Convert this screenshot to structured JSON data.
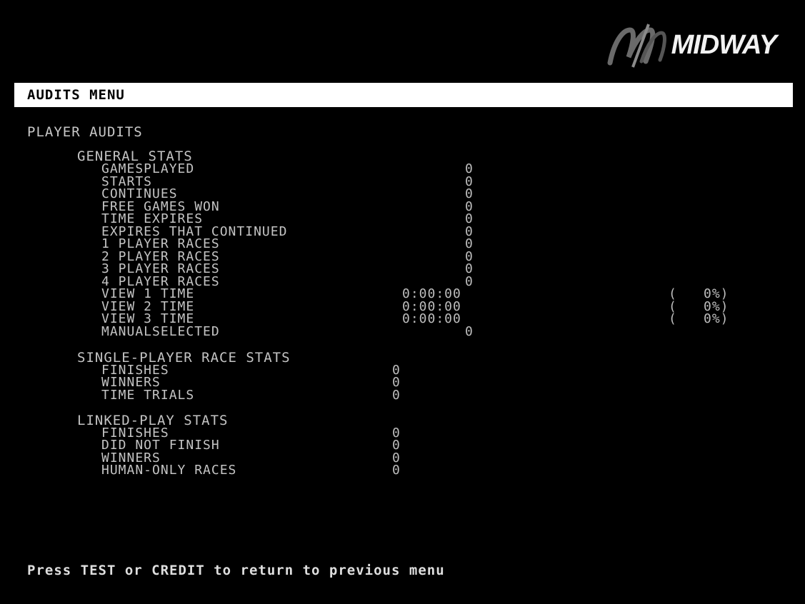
{
  "brand": {
    "logo_text": "MIDWAY",
    "logo_icon": "midway-m-logo"
  },
  "menu": {
    "title": "AUDITS MENU"
  },
  "section": {
    "title": "PLAYER AUDITS"
  },
  "general_stats": {
    "header": "GENERAL STATS",
    "rows": [
      {
        "label": "GAMESPLAYED",
        "value": "0"
      },
      {
        "label": "STARTS",
        "value": "0"
      },
      {
        "label": "CONTINUES",
        "value": "0"
      },
      {
        "label": "FREE GAMES WON",
        "value": "0"
      },
      {
        "label": "TIME EXPIRES",
        "value": "0"
      },
      {
        "label": "EXPIRES THAT CONTINUED",
        "value": "0"
      },
      {
        "label": "1 PLAYER RACES",
        "value": "0"
      },
      {
        "label": "2 PLAYER RACES",
        "value": "0"
      },
      {
        "label": "3 PLAYER RACES",
        "value": "0"
      },
      {
        "label": "4 PLAYER RACES",
        "value": "0"
      }
    ],
    "view_rows": [
      {
        "label": "VIEW 1 TIME",
        "value": "0:00:00",
        "pct_open": "(",
        "pct": "0%)"
      },
      {
        "label": "VIEW 2 TIME",
        "value": "0:00:00",
        "pct_open": "(",
        "pct": "0%)"
      },
      {
        "label": "VIEW 3 TIME",
        "value": "0:00:00",
        "pct_open": "(",
        "pct": "0%)"
      }
    ],
    "manual": {
      "label": "MANUALSELECTED",
      "value": "0"
    }
  },
  "single_player": {
    "header": "SINGLE-PLAYER RACE STATS",
    "rows": [
      {
        "label": "FINISHES",
        "value": "0"
      },
      {
        "label": "WINNERS",
        "value": "0"
      },
      {
        "label": "TIME TRIALS",
        "value": "0"
      }
    ]
  },
  "linked_play": {
    "header": "LINKED-PLAY STATS",
    "rows": [
      {
        "label": "FINISHES",
        "value": "0"
      },
      {
        "label": "DID NOT FINISH",
        "value": "0"
      },
      {
        "label": "WINNERS",
        "value": "0"
      },
      {
        "label": "HUMAN-ONLY RACES",
        "value": "0"
      }
    ]
  },
  "footer": {
    "text": "Press TEST or CREDIT to return to previous menu"
  },
  "colors": {
    "background": "#000000",
    "menu_bar": "#ffffff",
    "text": "#c4c4c4"
  }
}
